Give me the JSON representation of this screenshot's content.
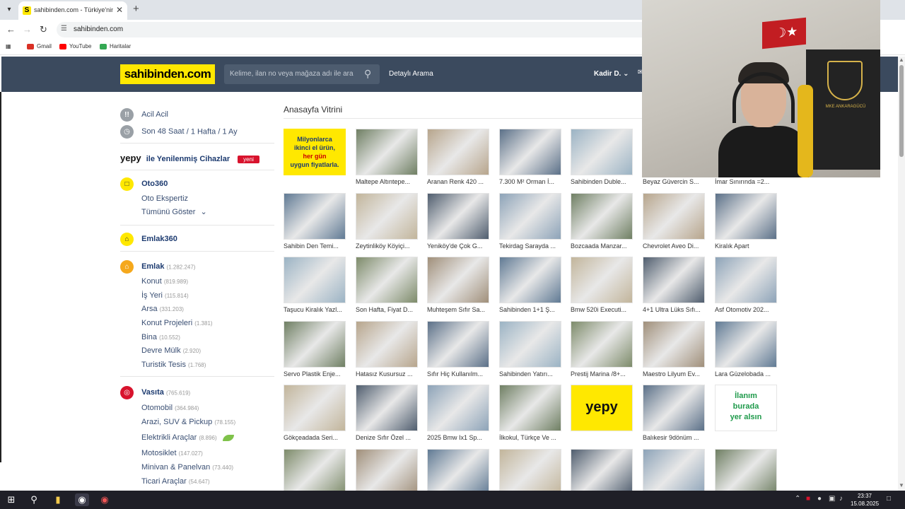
{
  "browser": {
    "tab_title": "sahibinden.com - Türkiye'nin O",
    "tab_favicon": "S",
    "url": "sahibinden.com",
    "bookmarks": [
      {
        "label": "Gmail",
        "icon": "gmail-icon",
        "color": "#d93025"
      },
      {
        "label": "YouTube",
        "icon": "youtube-icon",
        "color": "#ff0000"
      },
      {
        "label": "Haritalar",
        "icon": "maps-icon",
        "color": "#34a853"
      }
    ]
  },
  "header": {
    "logo": "sahibinden.com",
    "search_placeholder": "Kelime, ilan no veya mağaza adı ile ara",
    "advanced_search": "Detaylı Arama",
    "user_name": "Kadir D."
  },
  "sidebar": {
    "urgent": "Acil Acil",
    "time_filters": [
      "Son 48 Saat",
      "1 Hafta",
      "1 Ay"
    ],
    "yepy_label": "yepy",
    "yepy_text": "ile Yenilenmiş Cihazlar",
    "yeni_badge": "yeni",
    "oto360": "Oto360",
    "oto_expertiz": "Oto Ekspertiz",
    "show_all": "Tümünü Göster",
    "emlak360": "Emlak360",
    "emlak": {
      "label": "Emlak",
      "count": "(1.282.247)"
    },
    "emlak_items": [
      {
        "label": "Konut",
        "count": "(819.989)"
      },
      {
        "label": "İş Yeri",
        "count": "(115.814)"
      },
      {
        "label": "Arsa",
        "count": "(331.203)"
      },
      {
        "label": "Konut Projeleri",
        "count": "(1.381)"
      },
      {
        "label": "Bina",
        "count": "(10.552)"
      },
      {
        "label": "Devre Mülk",
        "count": "(2.920)"
      },
      {
        "label": "Turistik Tesis",
        "count": "(1.768)"
      }
    ],
    "vasita": {
      "label": "Vasıta",
      "count": "(765.619)"
    },
    "vasita_items": [
      {
        "label": "Otomobil",
        "count": "(364.984)"
      },
      {
        "label": "Arazi, SUV & Pickup",
        "count": "(78.155)"
      },
      {
        "label": "Elektrikli Araçlar",
        "count": "(8.896)"
      },
      {
        "label": "Motosiklet",
        "count": "(147.027)"
      },
      {
        "label": "Minivan & Panelvan",
        "count": "(73.440)"
      },
      {
        "label": "Ticari Araçlar",
        "count": "(54.647)"
      }
    ]
  },
  "main": {
    "title": "Anasayfa Vitrini",
    "ad_text": [
      "Milyonlarca",
      "ikinci el ürün,",
      "her gün",
      "uygun fiyatlarla."
    ],
    "listings": [
      [
        "",
        "Maltepe Altıntepe...",
        "Aranan Renk 420 ...",
        "7.300 M² Orman İ...",
        "Sahibinden Duble...",
        "Beyaz Güvercin S...",
        "İmar Sınırında =2..."
      ],
      [
        "Sahibin Den Temi...",
        "Zeytinliköy Köyiçi...",
        "Yeniköy'de Çok G...",
        "Tekirdag Sarayda ...",
        "Bozcaada Manzar...",
        "Chevrolet Aveo Di...",
        "Kiralık Apart"
      ],
      [
        "Taşucu Kiralık Yazl...",
        "Son Hafta, Fiyat D...",
        "Muhteşem Sıfır Sa...",
        "Sahibinden 1+1 Ş...",
        "Bmw 520i Executi...",
        "4+1 Ultra Lüks Sıfı...",
        "Asf Otomotiv 202..."
      ],
      [
        "Servo Plastik Enje...",
        "Hatasız Kusursuz ...",
        "Sıfır Hiç Kullanılm...",
        "Sahibinden Yatırı...",
        "Prestij Marina /8+...",
        "Maestro Lilyum Ev...",
        "Lara Güzelobada ..."
      ],
      [
        "Gökçeadada Seri...",
        "Denize Sıfır Özel ...",
        "2025 Bmw Ix1 Sp...",
        "İlkokul, Türkçe Ve ...",
        "",
        "Balıkesir 9dönüm ...",
        ""
      ],
      [
        "",
        "",
        "",
        "",
        "",
        "",
        ""
      ]
    ],
    "yepy_promo": "yepy",
    "ilan_promo": [
      "İlanım",
      "burada",
      "yer alsın"
    ]
  },
  "webcam": {
    "poster_text": "MKE ANKARAGÜCÜ"
  },
  "taskbar": {
    "time": "23:37",
    "date": "15.08.2025"
  }
}
